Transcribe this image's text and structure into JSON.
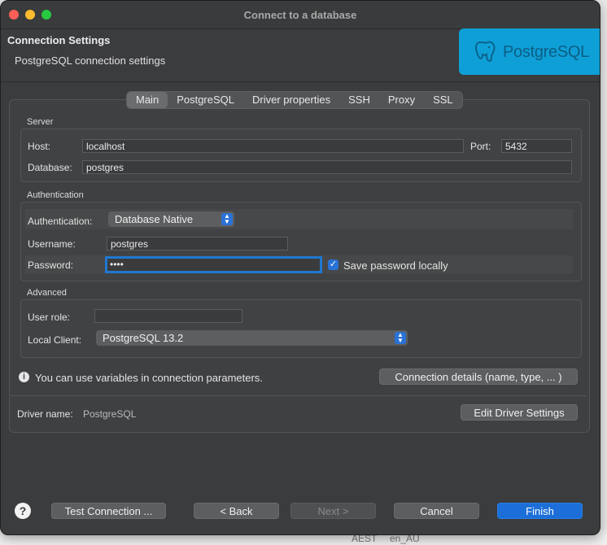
{
  "window": {
    "title": "Connect to a database"
  },
  "header": {
    "title": "Connection Settings",
    "subtitle": "PostgreSQL connection settings",
    "logo_text": "PostgreSQL"
  },
  "tabs": [
    {
      "label": "Main",
      "active": true
    },
    {
      "label": "PostgreSQL"
    },
    {
      "label": "Driver properties"
    },
    {
      "label": "SSH"
    },
    {
      "label": "Proxy"
    },
    {
      "label": "SSL"
    }
  ],
  "server": {
    "group_label": "Server",
    "host_label": "Host:",
    "host_value": "localhost",
    "port_label": "Port:",
    "port_value": "5432",
    "database_label": "Database:",
    "database_value": "postgres"
  },
  "authentication": {
    "group_label": "Authentication",
    "auth_label": "Authentication:",
    "auth_value": "Database Native",
    "username_label": "Username:",
    "username_value": "postgres",
    "password_label": "Password:",
    "password_value": "••••",
    "save_password_label": "Save password locally",
    "save_password_checked": true
  },
  "advanced": {
    "group_label": "Advanced",
    "user_role_label": "User role:",
    "user_role_value": "",
    "local_client_label": "Local Client:",
    "local_client_value": "PostgreSQL 13.2"
  },
  "info": {
    "variables_text": "You can use variables in connection parameters.",
    "connection_details_button": "Connection details (name, type, ... )"
  },
  "driver": {
    "label": "Driver name:",
    "value": "PostgreSQL",
    "edit_button": "Edit Driver Settings"
  },
  "footer": {
    "help": "?",
    "test_connection": "Test Connection ...",
    "back": "< Back",
    "next": "Next >",
    "cancel": "Cancel",
    "finish": "Finish"
  },
  "background_strip": {
    "left_text": "AEST",
    "right_text": "en_AU"
  },
  "colors": {
    "accent": "#1c6fd8",
    "logo_bg": "#0e9fd6",
    "window_bg": "#3b3c3e"
  }
}
